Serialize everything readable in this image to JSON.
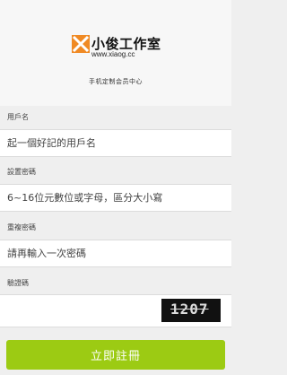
{
  "brand": {
    "name": "小俊工作室",
    "url": "www.xiaog.cc",
    "tagline": "手机定制会员中心"
  },
  "fields": [
    {
      "label": "用戶名",
      "placeholder": "起一個好記的用戶名"
    },
    {
      "label": "設置密碼",
      "placeholder": "6~16位元數位或字母，區分大小寫"
    },
    {
      "label": "重複密碼",
      "placeholder": "請再輸入一次密碼"
    },
    {
      "label": "驗證碼",
      "placeholder": "",
      "captcha": "1207"
    }
  ],
  "submit_label": "立即註冊",
  "colors": {
    "accent": "#9ccb13",
    "logo_orange": "#f08a24"
  }
}
